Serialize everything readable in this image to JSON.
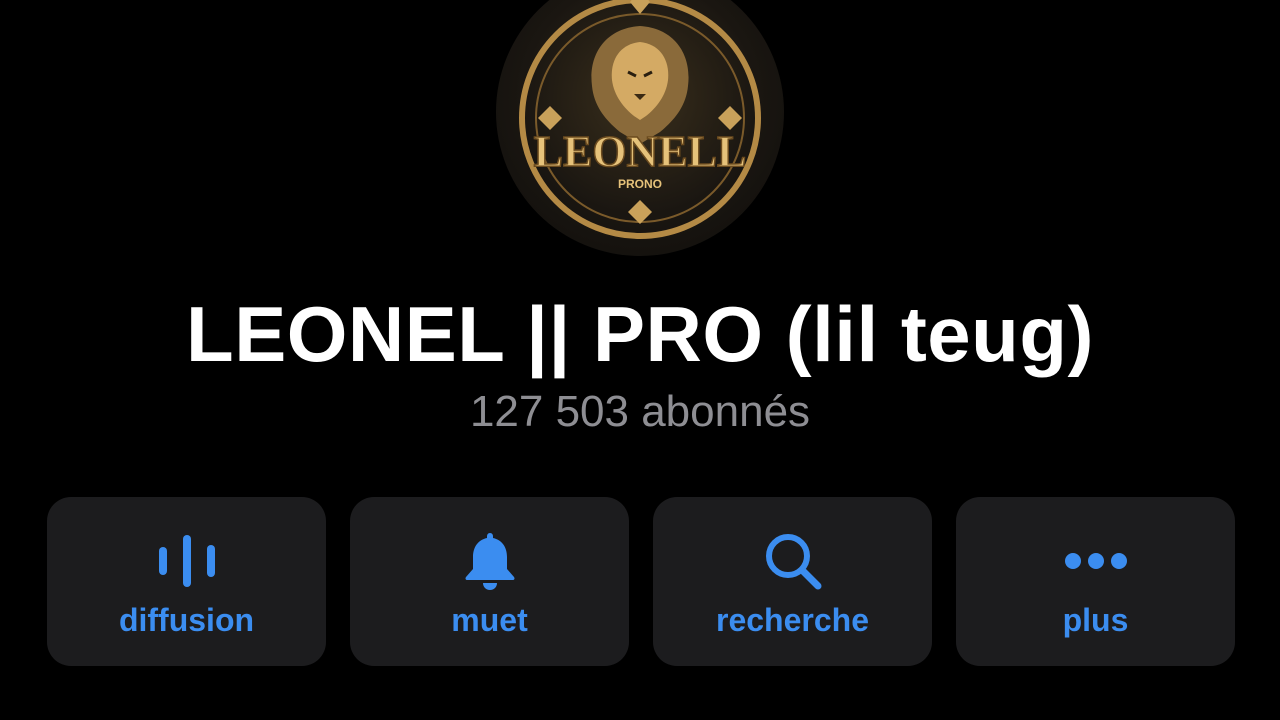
{
  "channel": {
    "avatar_text": "LEONELL",
    "avatar_subtext": "PRONO",
    "title": "LEONEL || PRO (lil teug)",
    "subscribers": "127 503 abonnés"
  },
  "actions": [
    {
      "label": "diffusion",
      "icon": "waveform-icon"
    },
    {
      "label": "muet",
      "icon": "bell-icon"
    },
    {
      "label": "recherche",
      "icon": "search-icon"
    },
    {
      "label": "plus",
      "icon": "more-dots-icon"
    }
  ],
  "colors": {
    "background": "#000000",
    "card": "#1c1c1e",
    "accent": "#3b8df0",
    "secondary_text": "#8e8e93",
    "gold": "#c9a15a"
  }
}
